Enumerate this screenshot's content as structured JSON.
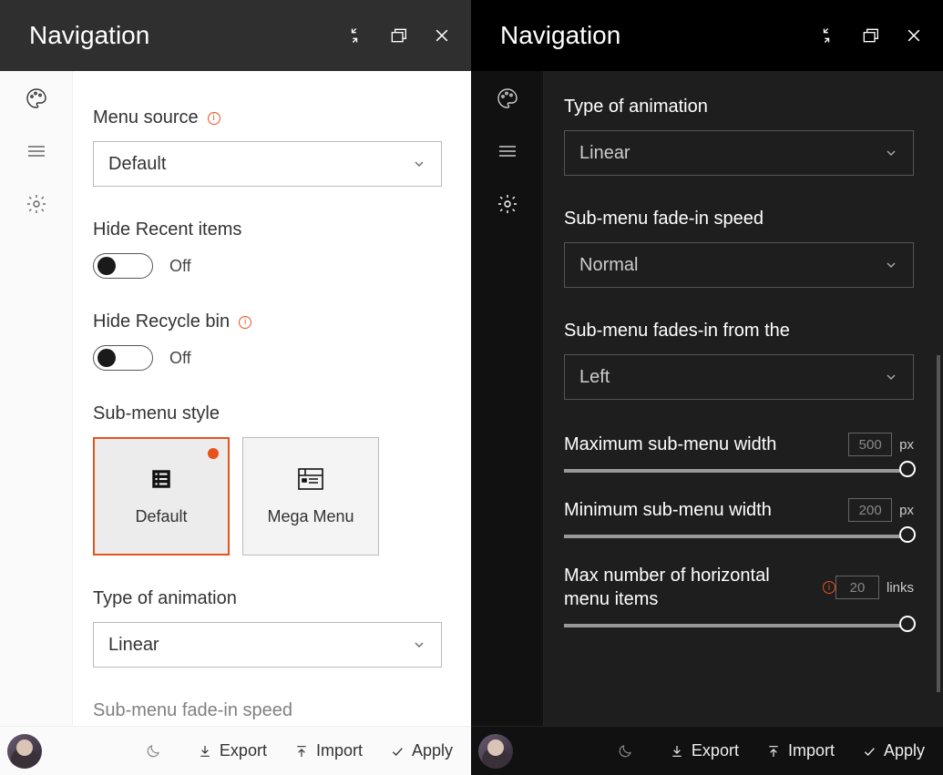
{
  "left": {
    "title": "Navigation",
    "menu_source_label": "Menu source",
    "menu_source_value": "Default",
    "hide_recent_label": "Hide Recent items",
    "hide_recent_state": "Off",
    "hide_recycle_label": "Hide Recycle bin",
    "hide_recycle_state": "Off",
    "submenu_style_label": "Sub-menu style",
    "tiles": [
      {
        "label": "Default",
        "selected": true
      },
      {
        "label": "Mega Menu",
        "selected": false
      }
    ],
    "anim_type_label": "Type of animation",
    "anim_type_value": "Linear",
    "fade_speed_cut": "Sub-menu fade-in speed"
  },
  "right": {
    "title": "Navigation",
    "anim_type_label": "Type of animation",
    "anim_type_value": "Linear",
    "fade_speed_label": "Sub-menu fade-in speed",
    "fade_speed_value": "Normal",
    "fade_from_label": "Sub-menu fades-in from the",
    "fade_from_value": "Left",
    "max_width_label": "Maximum sub-menu width",
    "max_width_value": "500",
    "min_width_label": "Minimum sub-menu width",
    "min_width_value": "200",
    "max_links_label": "Max number of horizontal menu items",
    "max_links_value": "20",
    "unit_px": "px",
    "unit_links": "links"
  },
  "footer": {
    "export": "Export",
    "import": "Import",
    "apply": "Apply"
  }
}
